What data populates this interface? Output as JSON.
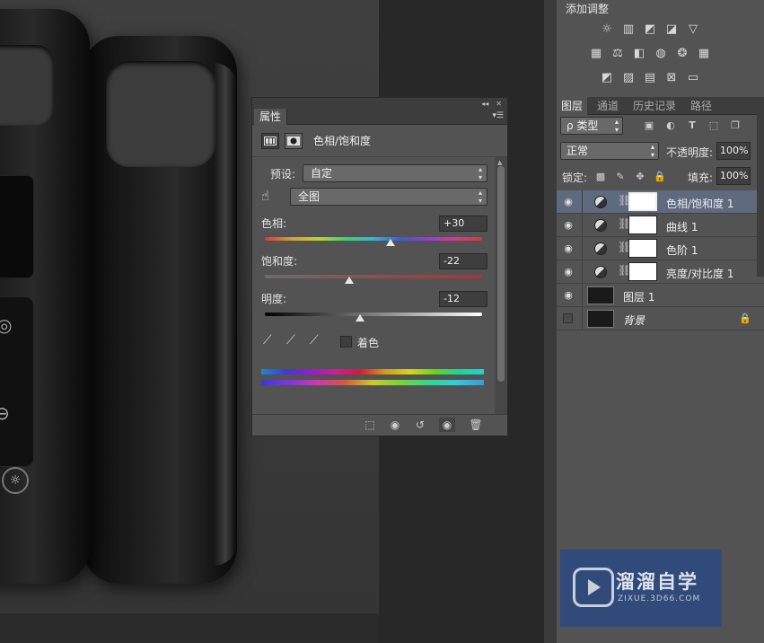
{
  "properties_panel": {
    "tab_label": "属性",
    "adjustment_title": "色相/饱和度",
    "preset_label": "预设:",
    "preset_value": "自定",
    "channel_value": "全图",
    "hue": {
      "label": "色相:",
      "value": "+30",
      "level": 0.58
    },
    "saturation": {
      "label": "饱和度:",
      "value": "-22",
      "level": 0.39
    },
    "lightness": {
      "label": "明度:",
      "value": "-12",
      "level": 0.44
    },
    "colorize_label": "着色",
    "colorize_checked": false
  },
  "adjustments_panel": {
    "title": "添加调整"
  },
  "layers_panel": {
    "tabs": [
      "图层",
      "通道",
      "历史记录",
      "路径"
    ],
    "active_tab": "图层",
    "filter_kind": "ρ 类型",
    "blend_mode": "正常",
    "opacity_label": "不透明度:",
    "opacity_value": "100%",
    "lock_label": "锁定:",
    "fill_label": "填充:",
    "fill_value": "100%",
    "layers": [
      {
        "name": "色相/饱和度 1",
        "type": "adjustment",
        "visible": true,
        "selected": true
      },
      {
        "name": "曲线 1",
        "type": "adjustment",
        "visible": true,
        "selected": false
      },
      {
        "name": "色阶 1",
        "type": "adjustment",
        "visible": true,
        "selected": false
      },
      {
        "name": "亮度/对比度 1",
        "type": "adjustment",
        "visible": true,
        "selected": false
      },
      {
        "name": "图层 1",
        "type": "pixel",
        "visible": true,
        "selected": false
      },
      {
        "name": "背景",
        "type": "pixel",
        "visible": false,
        "selected": false,
        "locked": true
      }
    ]
  },
  "watermark": {
    "title": "溜溜自学",
    "subtitle": "ZIXUE.3D66.COM"
  },
  "colors": {
    "panel_bg": "#535353",
    "panel_dark": "#3d3d3d",
    "selected_layer": "#5e6a7d",
    "watermark_bg": "#2f4a7c"
  }
}
